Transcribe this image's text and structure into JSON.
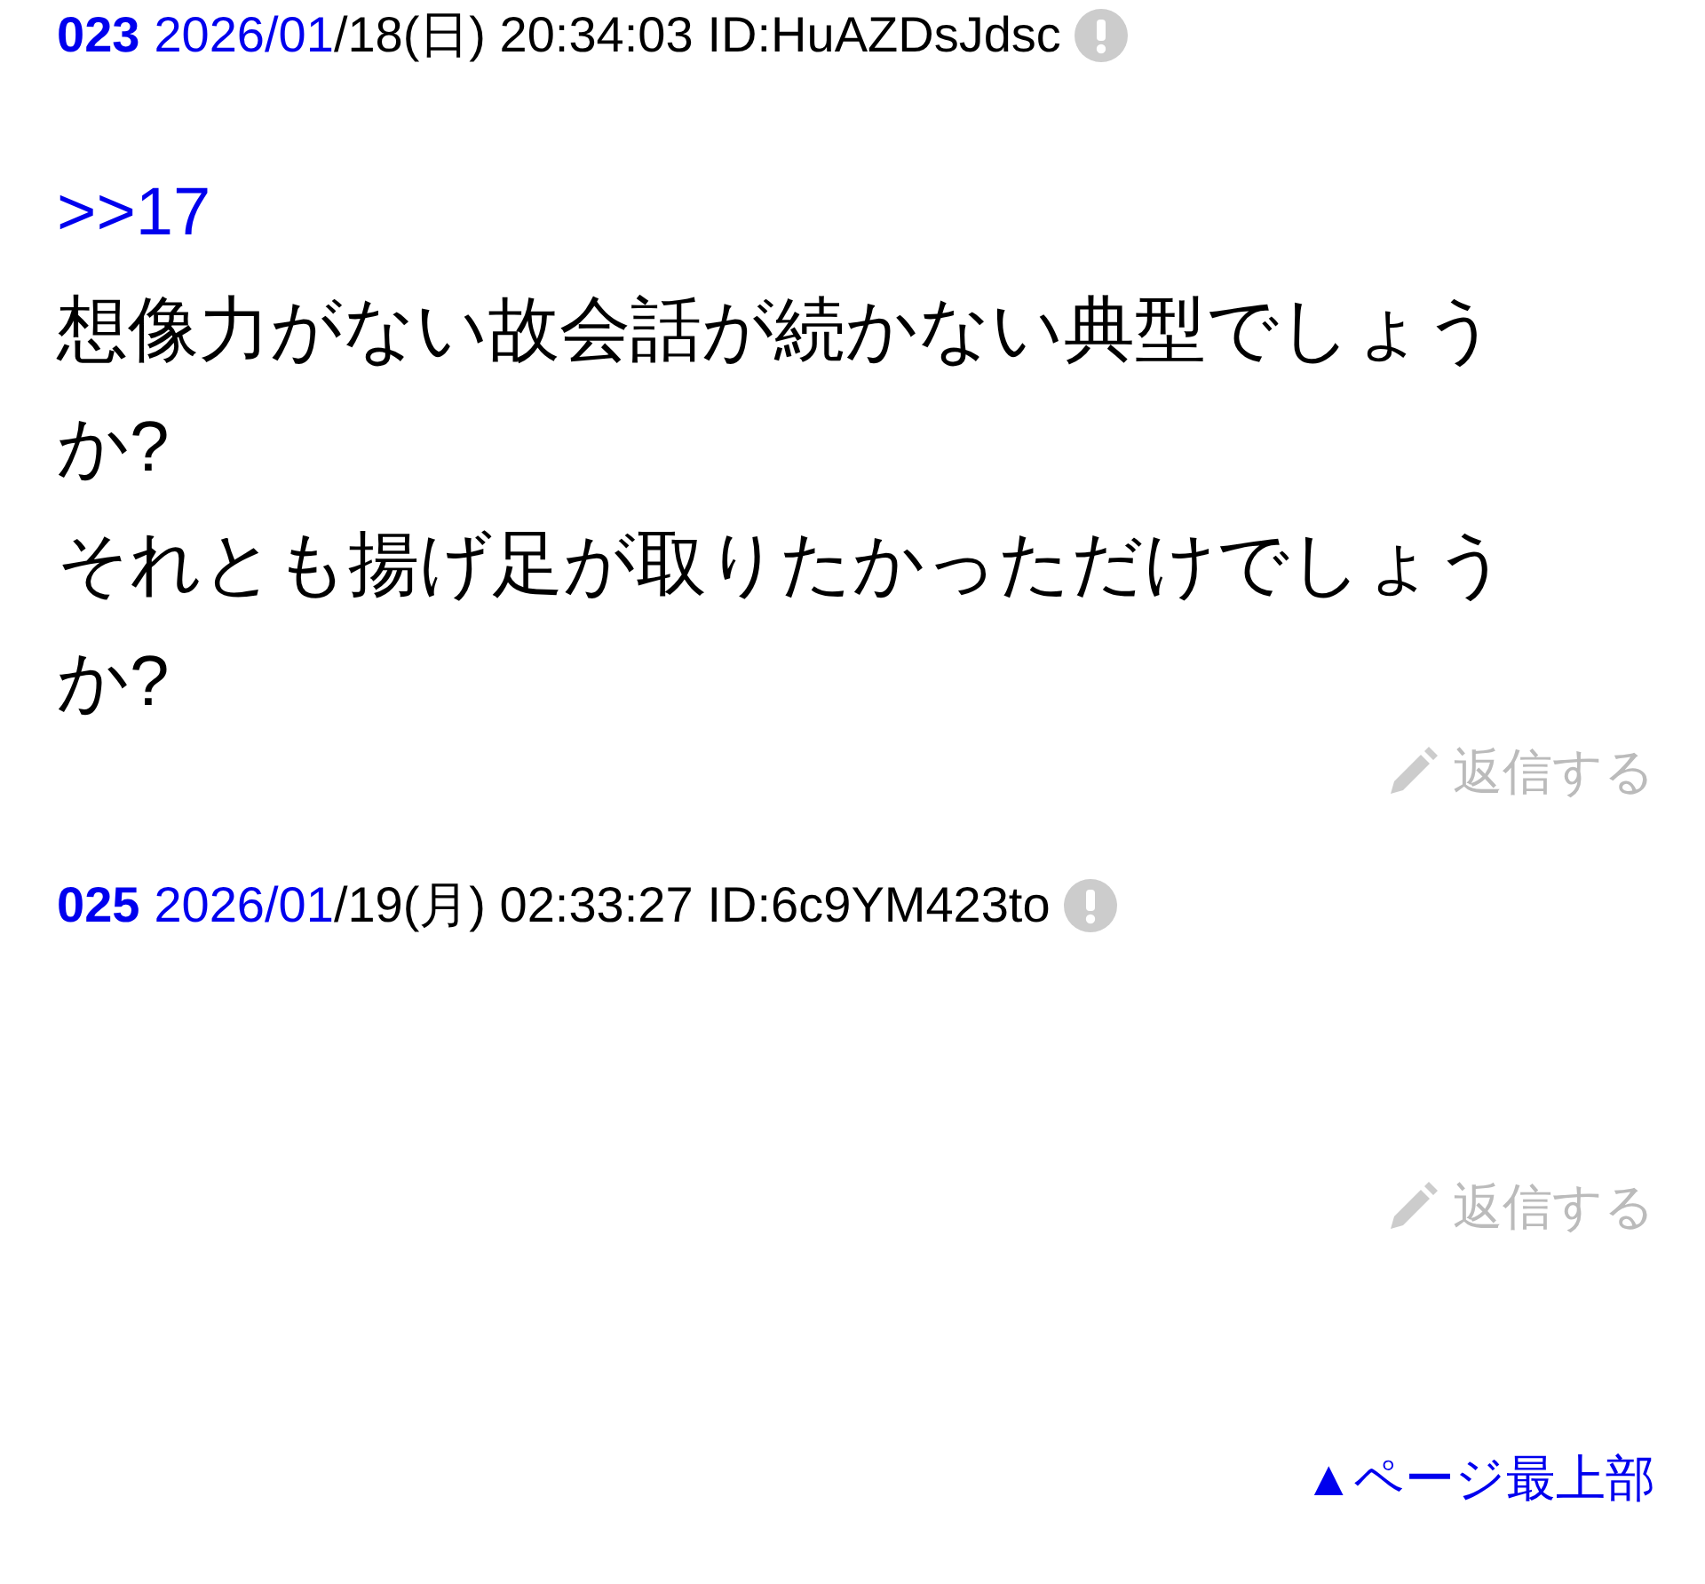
{
  "posts": [
    {
      "number": "023",
      "date_link": "2026/01",
      "date_rest": "/18(日) 20:34:03",
      "id": "ID:HuAZDsJdsc",
      "body": [
        {
          "kind": "anchor",
          "text": ">>17"
        },
        {
          "kind": "text",
          "text": "想像力がない故会話が続かない典型でしょうか?"
        },
        {
          "kind": "text",
          "text": "それとも揚げ足が取りたかっただけでしょうか?"
        }
      ],
      "reply": "返信する"
    },
    {
      "number": "025",
      "date_link": "2026/01",
      "date_rest": "/19(月) 02:33:27",
      "id": "ID:6c9YM423to",
      "reply": "返信する"
    }
  ],
  "footer_link": "▲ページ最上部"
}
